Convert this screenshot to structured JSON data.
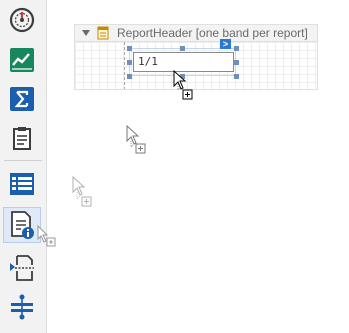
{
  "toolbox": {
    "items": [
      {
        "name": "gauge-tool",
        "icon": "gauge-icon"
      },
      {
        "name": "sparkline-tool",
        "icon": "sparkline-icon"
      },
      {
        "name": "summary-tool",
        "icon": "sigma-icon"
      },
      {
        "name": "clipboard-tool",
        "icon": "clipboard-icon"
      },
      {
        "name": "table-tool",
        "icon": "table-icon"
      },
      {
        "name": "page-info-tool",
        "icon": "page-info-icon",
        "selected": true
      },
      {
        "name": "page-break-tool",
        "icon": "page-break-icon"
      },
      {
        "name": "line-tool",
        "icon": "cross-band-line-icon"
      }
    ],
    "colors": {
      "accent": "#1a73c9",
      "green": "#17875e",
      "dark": "#3d3d3d",
      "selected_bg": "#dfe9f7"
    }
  },
  "designer": {
    "band": {
      "title": "ReportHeader [one band per report]",
      "chevron_icon": "chevron-down-icon",
      "band_icon": "report-header-icon"
    },
    "label_control": {
      "text": "1/1",
      "smart_tag_glyph": ">"
    }
  }
}
